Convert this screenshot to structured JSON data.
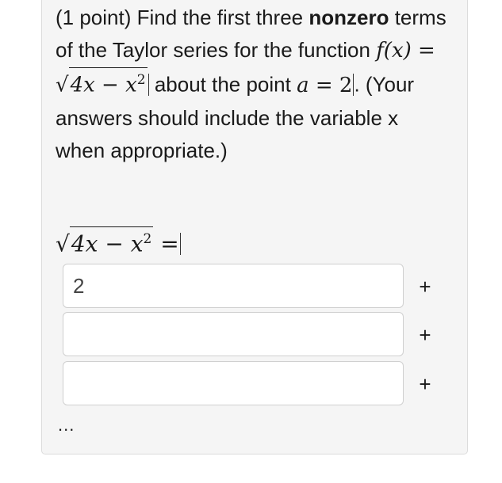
{
  "problem": {
    "prefix": "(1 point) Find the first three ",
    "bold_word": "nonzero",
    "line_part2": " terms of the Taylor series for the function ",
    "func_lhs": "f(x) =",
    "radicand": "4x − x",
    "exponent": "2",
    "about_text": " about the point ",
    "point_var": "a",
    "point_eq": "= 2",
    "suffix": ". (Your answers should include the variable x when appropriate.)"
  },
  "answer_section": {
    "lhs_radicand": "4x − x",
    "lhs_exponent": "2",
    "lhs_equals": "=",
    "inputs": [
      {
        "value": "2",
        "placeholder": ""
      },
      {
        "value": "",
        "placeholder": ""
      },
      {
        "value": "",
        "placeholder": ""
      }
    ],
    "add_label": "+",
    "ellipsis": "..."
  }
}
